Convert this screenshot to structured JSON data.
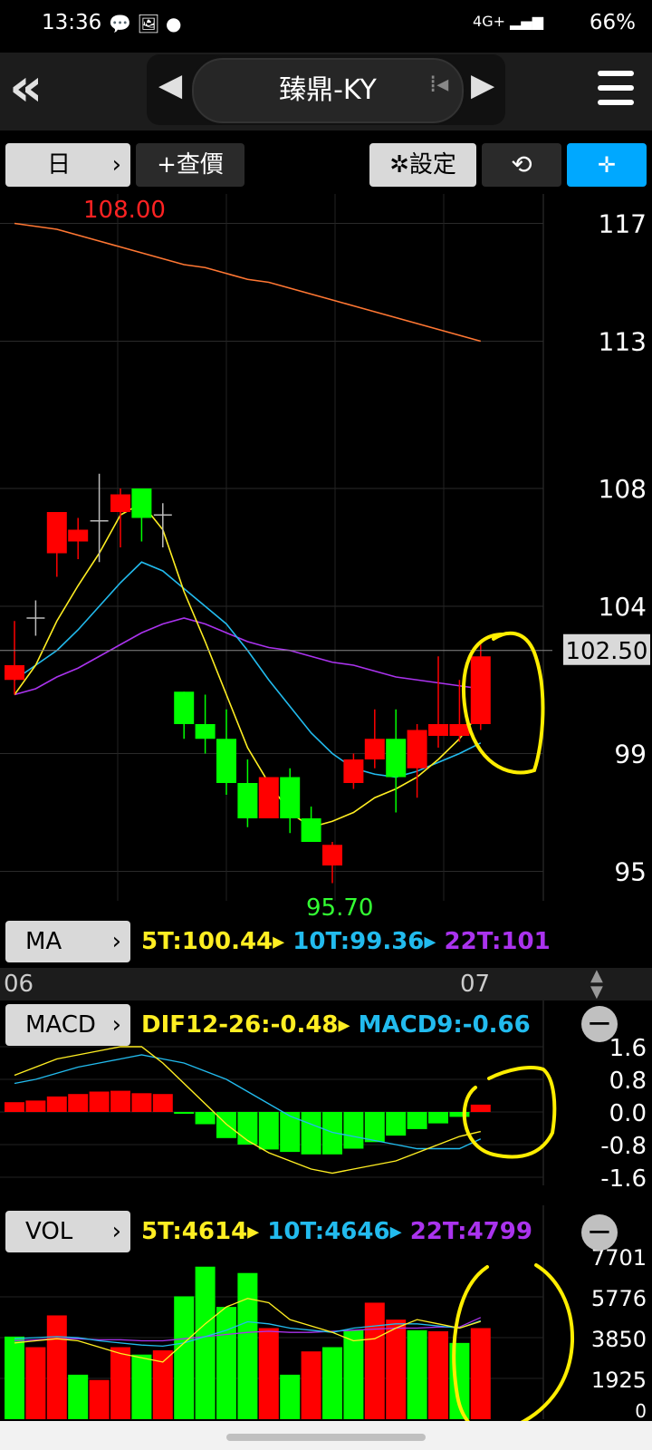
{
  "status": {
    "time": "13:36",
    "battery": "66%",
    "network": "4G+"
  },
  "nav": {
    "title": "臻鼎-KY"
  },
  "toolbar": {
    "period": "日",
    "query": "+查價",
    "settings": "設定"
  },
  "colors": {
    "ma5": "#ffee22",
    "ma10": "#22bbee",
    "ma22": "#aa33ee",
    "up": "#ff0000",
    "down": "#00ff00",
    "annot": "#ffee00"
  },
  "chart_data": [
    {
      "type": "candlestick",
      "ylim": [
        94,
        118
      ],
      "yticks": [
        117,
        113,
        108,
        104,
        99,
        95
      ],
      "current_price_label": "102.50",
      "high_label": "108.00",
      "low_label": "95.70",
      "xlabels": [
        {
          "label": "06",
          "index": 0
        },
        {
          "label": "07",
          "index": 21
        }
      ],
      "candles": [
        {
          "o": 101.5,
          "h": 103.5,
          "l": 101.0,
          "c": 102.0
        },
        {
          "o": 103.5,
          "h": 104.2,
          "l": 103.0,
          "c": 103.6
        },
        {
          "o": 105.8,
          "h": 107.2,
          "l": 105.0,
          "c": 107.2
        },
        {
          "o": 106.2,
          "h": 107.0,
          "l": 105.6,
          "c": 106.6
        },
        {
          "o": 106.8,
          "h": 108.5,
          "l": 105.5,
          "c": 106.9
        },
        {
          "o": 107.2,
          "h": 108.0,
          "l": 106.0,
          "c": 107.8
        },
        {
          "o": 108.0,
          "h": 108.0,
          "l": 106.2,
          "c": 107.0
        },
        {
          "o": 107.0,
          "h": 107.5,
          "l": 106.0,
          "c": 107.1
        },
        {
          "o": 101.1,
          "h": 101.1,
          "l": 99.5,
          "c": 100.0
        },
        {
          "o": 100.0,
          "h": 101.0,
          "l": 99.0,
          "c": 99.5
        },
        {
          "o": 99.5,
          "h": 100.5,
          "l": 97.6,
          "c": 98.0
        },
        {
          "o": 98.0,
          "h": 98.8,
          "l": 96.5,
          "c": 96.8
        },
        {
          "o": 96.8,
          "h": 98.2,
          "l": 96.8,
          "c": 98.2
        },
        {
          "o": 98.2,
          "h": 98.5,
          "l": 96.3,
          "c": 96.8
        },
        {
          "o": 96.8,
          "h": 97.2,
          "l": 96.0,
          "c": 96.0
        },
        {
          "o": 95.2,
          "h": 96.0,
          "l": 94.6,
          "c": 95.9
        },
        {
          "o": 98.0,
          "h": 99.0,
          "l": 97.8,
          "c": 98.8
        },
        {
          "o": 98.8,
          "h": 100.5,
          "l": 98.5,
          "c": 99.5
        },
        {
          "o": 99.5,
          "h": 100.5,
          "l": 97.0,
          "c": 98.2
        },
        {
          "o": 98.5,
          "h": 100.0,
          "l": 97.5,
          "c": 99.8
        },
        {
          "o": 99.6,
          "h": 102.3,
          "l": 99.2,
          "c": 100.0
        },
        {
          "o": 99.6,
          "h": 101.5,
          "l": 99.4,
          "c": 100.0
        },
        {
          "o": 100.0,
          "h": 102.7,
          "l": 99.8,
          "c": 102.3
        }
      ],
      "ma5": [
        101.0,
        102.0,
        103.5,
        104.7,
        105.8,
        107.1,
        107.5,
        106.6,
        104.5,
        102.8,
        101.0,
        99.2,
        98.0,
        97.0,
        96.5,
        96.7,
        97.0,
        97.5,
        97.8,
        98.2,
        98.8,
        99.5,
        100.44
      ],
      "ma10": [
        101.5,
        102.0,
        102.5,
        103.2,
        104.0,
        104.8,
        105.5,
        105.2,
        104.6,
        104.0,
        103.4,
        102.5,
        101.5,
        100.6,
        99.7,
        99.0,
        98.5,
        98.3,
        98.2,
        98.4,
        98.7,
        99.0,
        99.36
      ],
      "ma22": [
        101.0,
        101.2,
        101.6,
        101.9,
        102.3,
        102.7,
        103.1,
        103.4,
        103.6,
        103.4,
        103.1,
        102.8,
        102.6,
        102.5,
        102.3,
        102.1,
        102.0,
        101.8,
        101.6,
        101.5,
        101.4,
        101.3,
        101.2
      ],
      "ma60": [
        117.0,
        116.9,
        116.8,
        116.6,
        116.4,
        116.2,
        116.0,
        115.8,
        115.6,
        115.5,
        115.3,
        115.1,
        115.0,
        114.8,
        114.6,
        114.4,
        114.2,
        114.0,
        113.8,
        113.6,
        113.4,
        113.2,
        113.0
      ]
    },
    {
      "type": "macd",
      "ylim": [
        -1.8,
        1.8
      ],
      "yticks": [
        "1.6",
        "0.8",
        "0.0",
        "-0.8",
        "-1.6"
      ],
      "dif": [
        0.9,
        1.1,
        1.3,
        1.4,
        1.5,
        1.6,
        1.6,
        1.2,
        0.7,
        0.2,
        -0.3,
        -0.7,
        -1.0,
        -1.2,
        -1.4,
        -1.5,
        -1.4,
        -1.3,
        -1.2,
        -1.0,
        -0.8,
        -0.6,
        -0.48
      ],
      "macd9": [
        0.7,
        0.8,
        0.95,
        1.1,
        1.2,
        1.3,
        1.4,
        1.3,
        1.2,
        1.0,
        0.8,
        0.5,
        0.2,
        -0.1,
        -0.3,
        -0.5,
        -0.6,
        -0.7,
        -0.8,
        -0.9,
        -0.9,
        -0.9,
        -0.66
      ],
      "osc": [
        0.24,
        0.28,
        0.38,
        0.44,
        0.5,
        0.52,
        0.46,
        0.44,
        -0.04,
        -0.3,
        -0.64,
        -0.8,
        -0.92,
        -0.98,
        -1.04,
        -1.04,
        -0.9,
        -0.74,
        -0.58,
        -0.42,
        -0.28,
        -0.12,
        0.18
      ]
    },
    {
      "type": "bar",
      "ylim": [
        0,
        7701
      ],
      "yticks": [
        "7701",
        "5776",
        "3850",
        "1925",
        "0"
      ],
      "values": [
        3900,
        3400,
        4900,
        2100,
        1850,
        3400,
        3050,
        3250,
        5800,
        7200,
        5300,
        6900,
        4300,
        2100,
        3200,
        3400,
        4200,
        5500,
        4700,
        4200,
        4150,
        3600,
        4300
      ],
      "colors": [
        "down",
        "up",
        "up",
        "down",
        "up",
        "up",
        "down",
        "up",
        "down",
        "down",
        "down",
        "down",
        "up",
        "down",
        "up",
        "down",
        "down",
        "up",
        "up",
        "down",
        "up",
        "down",
        "up"
      ],
      "ma5": [
        3600,
        3700,
        3800,
        3700,
        3400,
        3100,
        2900,
        2700,
        3600,
        4500,
        5300,
        5700,
        5500,
        4700,
        4400,
        4100,
        3700,
        3800,
        4300,
        4700,
        4500,
        4300,
        4614
      ],
      "ma10": [
        3800,
        3850,
        3900,
        3850,
        3700,
        3600,
        3500,
        3450,
        3600,
        3900,
        4200,
        4600,
        4500,
        4300,
        4200,
        4100,
        4300,
        4400,
        4500,
        4500,
        4400,
        4300,
        4646
      ],
      "ma22": [
        3700,
        3750,
        3800,
        3800,
        3750,
        3750,
        3700,
        3700,
        3800,
        3900,
        4000,
        4100,
        4150,
        4100,
        4100,
        4150,
        4200,
        4250,
        4300,
        4300,
        4350,
        4350,
        4799
      ]
    }
  ],
  "ma_panel": {
    "label": "MA",
    "ma5": "5T:100.44",
    "ma10": "10T:99.36",
    "ma22": "22T:101"
  },
  "macd_panel": {
    "label": "MACD",
    "dif": "DIF12-26:-0.48",
    "macd9": "MACD9:-0.66"
  },
  "vol_panel": {
    "label": "VOL",
    "ma5": "5T:4614",
    "ma10": "10T:4646",
    "ma22": "22T:4799"
  }
}
